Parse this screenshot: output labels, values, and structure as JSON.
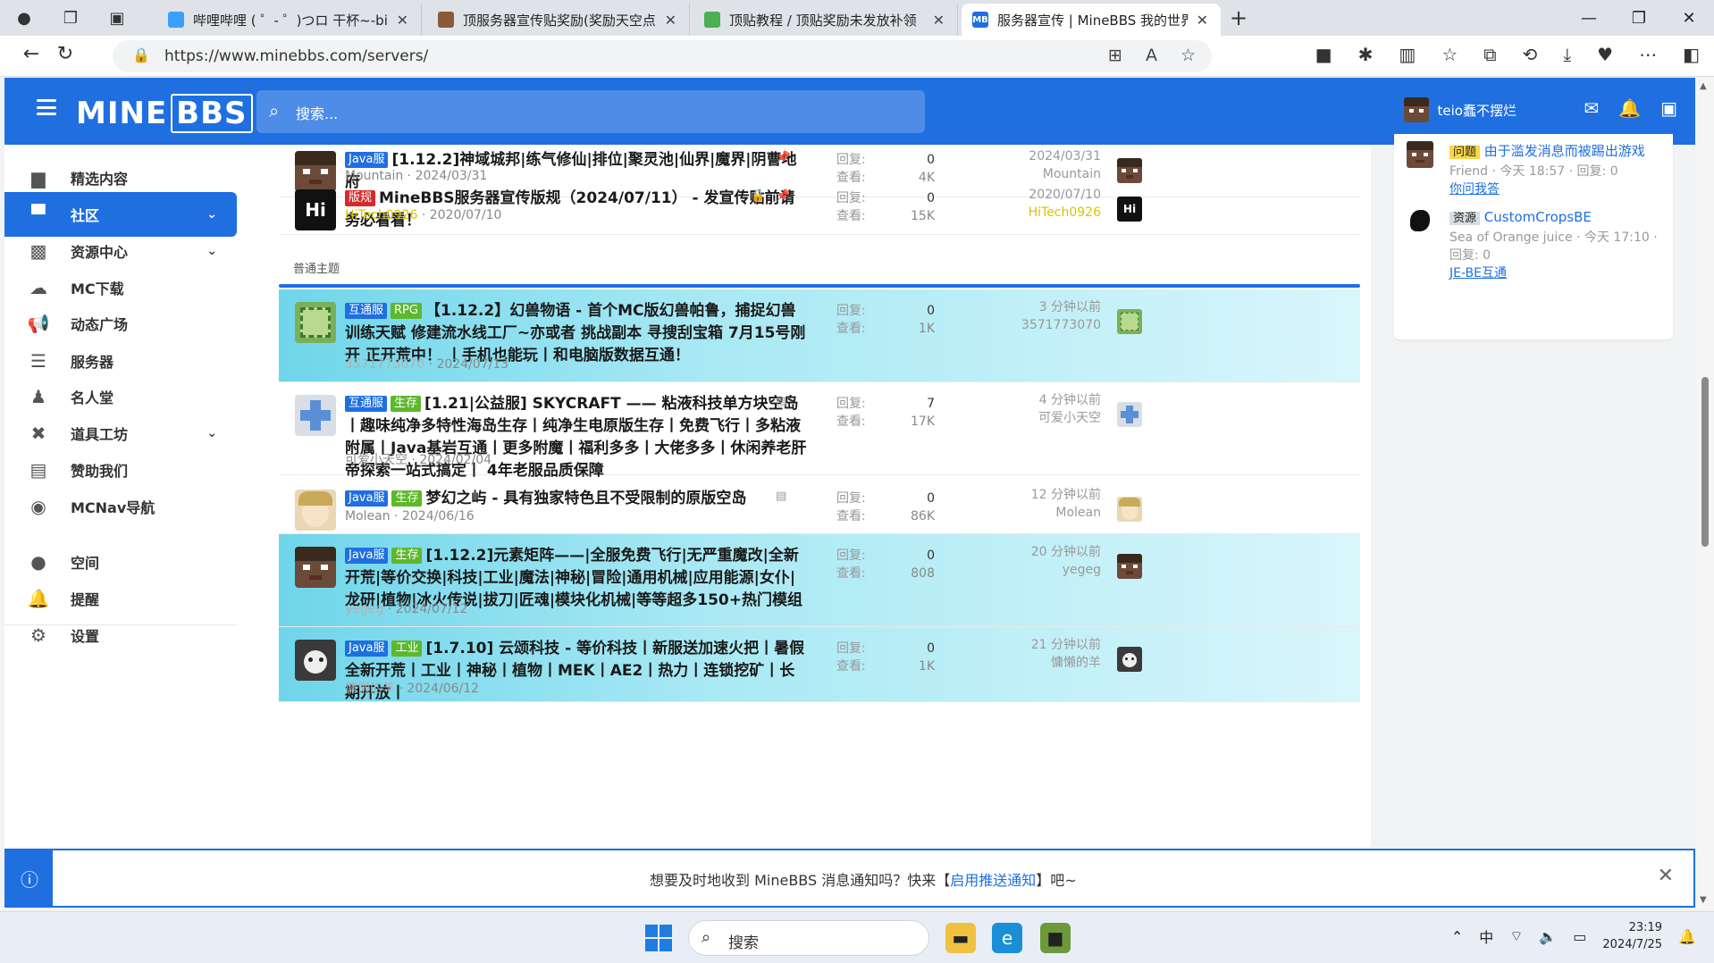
{
  "browser": {
    "tabs": [
      {
        "title": "哔哩哔哩 ( ゜- ゜)つロ 干杯~-bilib",
        "favicon_color": "#3aa0ff"
      },
      {
        "title": "顶服务器宣传贴奖励(奖励天空点",
        "favicon_color": "#8a5a3b"
      },
      {
        "title": "顶贴教程 / 顶贴奖励未发放补领",
        "favicon_color": "#4caf50"
      },
      {
        "title": "服务器宣传 | MineBBS 我的世界",
        "favicon_color": "#1f6fe0",
        "favicon_text": "MB"
      }
    ],
    "url": "https://www.minebbs.com/servers/"
  },
  "header": {
    "logo_text": "MINE",
    "logo_bbs": "BBS",
    "search_placeholder": "搜索...",
    "username": "teio蠢不摆烂"
  },
  "sidebar": {
    "items": [
      {
        "label": "精选内容",
        "icon": "folder-icon"
      },
      {
        "label": "社区",
        "icon": "chat-icon",
        "active": true,
        "chevron": true
      },
      {
        "label": "资源中心",
        "icon": "resources-icon",
        "chevron": true
      },
      {
        "label": "MC下载",
        "icon": "cloud-download-icon"
      },
      {
        "label": "动态广场",
        "icon": "megaphone-icon"
      },
      {
        "label": "服务器",
        "icon": "server-icon"
      },
      {
        "label": "名人堂",
        "icon": "user-tie-icon"
      },
      {
        "label": "道具工坊",
        "icon": "tools-icon",
        "chevron": true
      },
      {
        "label": "赞助我们",
        "icon": "sponsor-icon"
      },
      {
        "label": "MCNav导航",
        "icon": "compass-icon"
      },
      {
        "label": "空间",
        "icon": "person-icon"
      },
      {
        "label": "提醒",
        "icon": "bell-icon"
      },
      {
        "label": "设置",
        "icon": "gear-icon"
      }
    ]
  },
  "threads_sticky": [
    {
      "badges": [
        {
          "text": "Java服",
          "cls": "b-java"
        }
      ],
      "title": "[1.12.2]神域城邦|练气修仙|排位|聚灵池|仙界|魔界|阴曹地府",
      "author": "Mountain",
      "date": "2024/03/31",
      "replies": "0",
      "views": "4K",
      "last_date": "2024/03/31",
      "last_user": "Mountain"
    },
    {
      "badges": [
        {
          "text": "版规",
          "cls": "b-rule"
        }
      ],
      "title": "MineBBS服务器宣传版规（2024/07/11） - 发宣传贴前请务必看看！",
      "author": "HiTech0926",
      "date": "2020/07/10",
      "replies": "0",
      "views": "15K",
      "last_date": "2020/07/10",
      "last_user": "HiTech0926"
    }
  ],
  "section_label": "普通主题",
  "threads": [
    {
      "badges": [
        {
          "text": "互通服",
          "cls": "b-hutong"
        },
        {
          "text": "RPG",
          "cls": "b-rpg"
        }
      ],
      "title": "【1.12.2】幻兽物语 - 首个MC版幻兽帕鲁，捕捉幻兽 训练天赋 修建流水线工厂~亦或者 挑战副本 寻搜刮宝箱 7月15号刚开 正开荒中！ 丨手机也能玩丨和电脑版数据互通！",
      "author": "3571773070",
      "date": "2024/07/13",
      "replies": "0",
      "views": "1K",
      "last_date": "3 分钟以前",
      "last_user": "3571773070"
    },
    {
      "badges": [
        {
          "text": "互通服",
          "cls": "b-hutong"
        },
        {
          "text": "生存",
          "cls": "b-live"
        }
      ],
      "title": "[1.21|公益服] SKYCRAFT —— 粘液科技单方块空岛丨趣味纯净多特性海岛生存丨纯净生电原版生存丨免费飞行丨多粘液附属丨Java基岩互通丨更多附魔丨福利多多丨大佬多多丨休闲养老肝帝探索一站式搞定丨 4年老服品质保障",
      "author": "可爱小天空",
      "date": "2024/02/04",
      "replies": "7",
      "views": "17K",
      "last_date": "4 分钟以前",
      "last_user": "可爱小天空"
    },
    {
      "badges": [
        {
          "text": "Java服",
          "cls": "b-java"
        },
        {
          "text": "生存",
          "cls": "b-live"
        }
      ],
      "title": "梦幻之屿 - 具有独家特色且不受限制的原版空岛",
      "author": "Molean",
      "date": "2024/06/16",
      "replies": "0",
      "views": "86K",
      "last_date": "12 分钟以前",
      "last_user": "Molean"
    },
    {
      "badges": [
        {
          "text": "Java服",
          "cls": "b-java"
        },
        {
          "text": "生存",
          "cls": "b-live"
        }
      ],
      "title": "[1.12.2]元素矩阵——|全服免费飞行|无严重魔改|全新开荒|等价交换|科技|工业|魔法|神秘|冒险|通用机械|应用能源|女仆|龙研|植物|冰火传说|拔刀|匠魂|模块化机械|等等超多150+热门模组",
      "author": "yegeg",
      "date": "2024/07/12",
      "replies": "0",
      "views": "808",
      "last_date": "20 分钟以前",
      "last_user": "yegeg"
    },
    {
      "badges": [
        {
          "text": "Java服",
          "cls": "b-java"
        },
        {
          "text": "工业",
          "cls": "b-ind"
        }
      ],
      "title": "[1.7.10] 云颂科技 - 等价科技丨新服送加速火把丨暑假全新开荒丨工业丨神秘丨植物丨MEK丨AE2丨热力丨连锁挖矿丨长期开放丨",
      "author": "慵懒的羊",
      "date": "2024/06/12",
      "replies": "0",
      "views": "1K",
      "last_date": "21 分钟以前",
      "last_user": "慵懒的羊"
    }
  ],
  "stats_labels": {
    "replies": "回复:",
    "views": "查看:"
  },
  "right_widget": [
    {
      "tag": "问题",
      "title": "由于滥发消息而被踢出游戏",
      "meta": "Friend · 今天 18:57 · 回复:",
      "replies": "0",
      "link": "你问我答"
    },
    {
      "tag": "资源",
      "title": "CustomCropsBE",
      "meta": "Sea of Orange juice · 今天 17:10 · 回复:",
      "replies": "0",
      "link": "JE-BE互通"
    }
  ],
  "notification": {
    "text_before": "想要及时地收到 MineBBS 消息通知吗？快来【",
    "link": "启用推送通知",
    "text_after": "】吧~"
  },
  "taskbar": {
    "search_placeholder": "搜索",
    "time": "23:19",
    "date": "2024/7/25",
    "ime": "中"
  }
}
